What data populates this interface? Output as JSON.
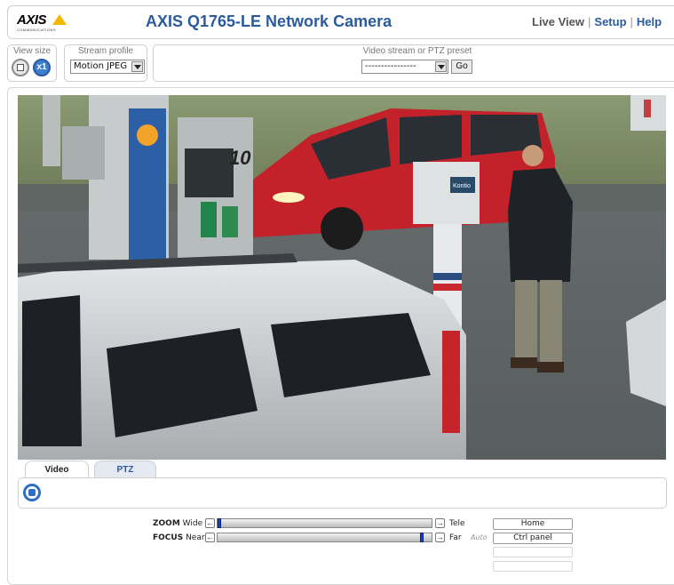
{
  "header": {
    "logo_text": "AXIS",
    "logo_sub": "COMMUNICATIONS",
    "title": "AXIS Q1765-LE Network Camera",
    "nav": {
      "live_view": "Live View",
      "separator": "|",
      "setup": "Setup",
      "help": "Help"
    }
  },
  "toolbar": {
    "view_size": {
      "label": "View size",
      "x1_label": "x1"
    },
    "stream_profile": {
      "label": "Stream profile",
      "selected": "Motion JPEG"
    },
    "preset": {
      "label": "Video stream or PTZ preset",
      "selected": "----------------",
      "go_label": "Go"
    }
  },
  "tabs": [
    {
      "label": "Video",
      "active": true
    },
    {
      "label": "PTZ",
      "active": false
    }
  ],
  "ptz_controls": {
    "zoom": {
      "label": "ZOOM",
      "min_label": "Wide",
      "max_label": "Tele",
      "level": 0.0
    },
    "focus": {
      "label": "FOCUS",
      "min_label": "Near",
      "max_label": "Far",
      "auto_label": "Auto",
      "level": 0.96
    },
    "arrow_left": "←",
    "arrow_right": "→",
    "buttons": {
      "home": "Home",
      "ctrl_panel": "Ctrl panel"
    }
  },
  "video_scene": {
    "pump_number": "10",
    "sign_text": "Kontio"
  },
  "colors": {
    "brand_blue": "#2a5b9e",
    "logo_yellow": "#f5b800",
    "slider_thumb": "#1a3fbf"
  },
  "icons": {
    "fit_view": "fit-view-icon",
    "x1_view": "x1-view-icon",
    "stop": "stop-icon",
    "dropdown": "chevron-down-icon"
  }
}
